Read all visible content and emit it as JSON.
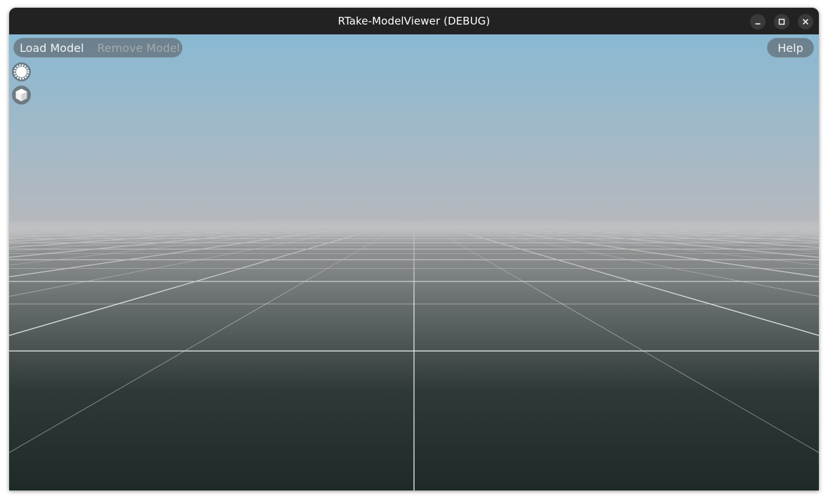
{
  "window": {
    "title": "RTake-ModelViewer (DEBUG)"
  },
  "titlebar_buttons": [
    {
      "name": "minimize",
      "icon": "minimize-icon"
    },
    {
      "name": "maximize",
      "icon": "maximize-icon"
    },
    {
      "name": "close",
      "icon": "close-icon"
    }
  ],
  "toolbar": {
    "load_label": "Load Model",
    "remove_label": "Remove Model"
  },
  "help": {
    "label": "Help"
  },
  "side_tools": [
    {
      "name": "lighting-toggle",
      "icon": "sun-gear-icon"
    },
    {
      "name": "model-view-toggle",
      "icon": "cube-icon"
    }
  ],
  "scene": {
    "sky_top": "#89b9d3",
    "sky_horizon": "#b6b8bc",
    "ground_far": "#8f9292",
    "ground_near": "#1e2a27",
    "grid_color": "#ffffff"
  }
}
